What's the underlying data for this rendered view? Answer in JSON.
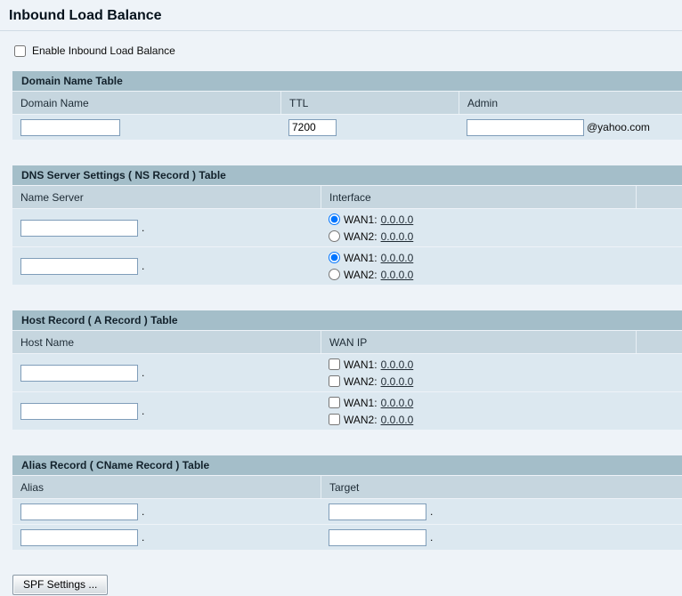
{
  "colors": {
    "page_background": "#eef3f8",
    "section_header_bg": "#a4bec9",
    "column_header_bg": "#c6d6df",
    "row_bg": "#dce8f0",
    "input_border": "#7f9db9",
    "link_color": "#1f2a33"
  },
  "page": {
    "title": "Inbound Load Balance",
    "enable_checkbox_label": "Enable Inbound Load Balance",
    "spf_button_label": "SPF Settings ..."
  },
  "domain_table": {
    "title": "Domain Name Table",
    "columns": {
      "domain": "Domain Name",
      "ttl": "TTL",
      "admin": "Admin"
    },
    "row": {
      "domain_value": "",
      "ttl_value": "7200",
      "admin_value": "",
      "admin_suffix": "@yahoo.com"
    }
  },
  "ns_table": {
    "title": "DNS Server Settings ( NS Record ) Table",
    "columns": {
      "name_server": "Name Server",
      "interface": "Interface"
    },
    "rows": [
      {
        "name_value": "",
        "suffix": ".",
        "wan1_label": "WAN1:",
        "wan1_ip": "0.0.0.0",
        "wan1_checked": "checked",
        "wan2_label": "WAN2:",
        "wan2_ip": "0.0.0.0"
      },
      {
        "name_value": "",
        "suffix": ".",
        "wan1_label": "WAN1:",
        "wan1_ip": "0.0.0.0",
        "wan1_checked": "checked",
        "wan2_label": "WAN2:",
        "wan2_ip": "0.0.0.0"
      }
    ]
  },
  "host_table": {
    "title": "Host Record ( A Record ) Table",
    "columns": {
      "host_name": "Host Name",
      "wan_ip": "WAN IP"
    },
    "rows": [
      {
        "host_value": "",
        "suffix": ".",
        "wan1_label": "WAN1:",
        "wan1_ip": "0.0.0.0",
        "wan2_label": "WAN2:",
        "wan2_ip": "0.0.0.0"
      },
      {
        "host_value": "",
        "suffix": ".",
        "wan1_label": "WAN1:",
        "wan1_ip": "0.0.0.0",
        "wan2_label": "WAN2:",
        "wan2_ip": "0.0.0.0"
      }
    ]
  },
  "alias_table": {
    "title": "Alias Record ( CName Record ) Table",
    "columns": {
      "alias": "Alias",
      "target": "Target"
    },
    "rows": [
      {
        "alias_value": "",
        "alias_suffix": ".",
        "target_value": "",
        "target_suffix": "."
      },
      {
        "alias_value": "",
        "alias_suffix": ".",
        "target_value": "",
        "target_suffix": "."
      }
    ]
  }
}
